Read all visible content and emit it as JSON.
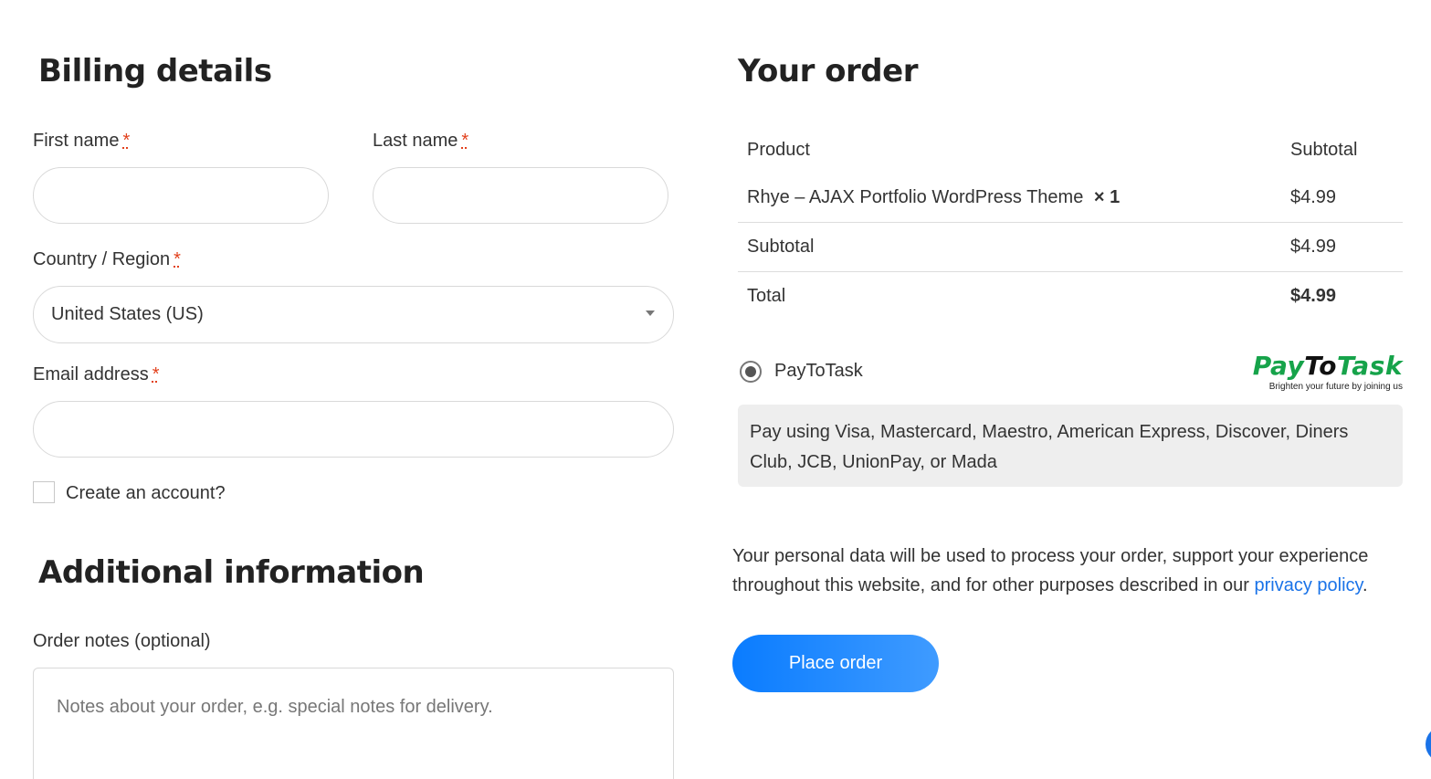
{
  "billing": {
    "title": "Billing details",
    "first_name_label": "First name",
    "last_name_label": "Last name",
    "country_label": "Country / Region",
    "country_value": "United States (US)",
    "email_label": "Email address",
    "required_mark": "*",
    "create_account_label": "Create an account?"
  },
  "additional": {
    "title": "Additional information",
    "notes_label": "Order notes (optional)",
    "notes_placeholder": "Notes about your order, e.g. special notes for delivery."
  },
  "order": {
    "title": "Your order",
    "col_product": "Product",
    "col_subtotal": "Subtotal",
    "item_name": "Rhye – AJAX Portfolio WordPress Theme",
    "item_qty": "× 1",
    "item_price": "$4.99",
    "subtotal_label": "Subtotal",
    "subtotal_value": "$4.99",
    "total_label": "Total",
    "total_value": "$4.99"
  },
  "payment": {
    "method_label": "PayToTask",
    "selected": true,
    "logo_pay": "Pay",
    "logo_to": "To",
    "logo_task": "Task",
    "logo_tagline": "Brighten your future by joining us",
    "logo_colors": {
      "green": "#16a34a",
      "dark": "#111111"
    },
    "description": "Pay using Visa, Mastercard, Maestro, American Express, Discover, Diners Club, JCB, UnionPay, or Mada"
  },
  "privacy": {
    "text_before": "Your personal data will be used to process your order, support your experience throughout this website, and for other purposes described in our ",
    "link_text": "privacy policy",
    "text_after": "."
  },
  "place_order_label": "Place order",
  "colors": {
    "accent": "#0a7cff",
    "link": "#1a73e8",
    "required": "#e2401c"
  }
}
